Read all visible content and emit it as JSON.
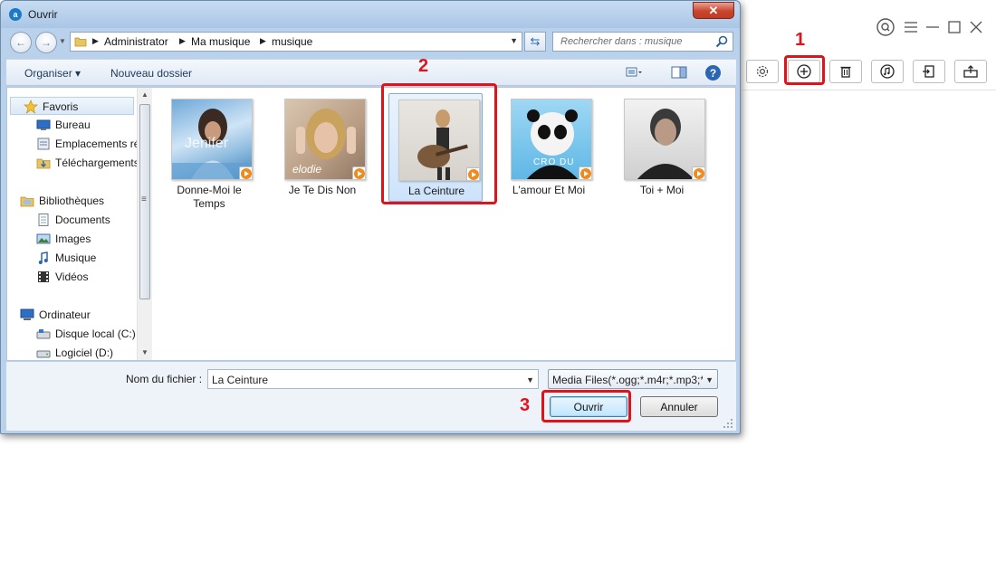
{
  "dialog": {
    "title": "Ouvrir",
    "close_symbol": "✕",
    "breadcrumb": [
      "Administrator",
      "Ma musique",
      "musique"
    ],
    "search_placeholder": "Rechercher dans : musique",
    "toolbar": {
      "organize": "Organiser ▾",
      "new_folder": "Nouveau dossier",
      "help": "?"
    },
    "nav": {
      "favorites": {
        "label": "Favoris",
        "items": [
          "Bureau",
          "Emplacements ré",
          "Téléchargements"
        ]
      },
      "libraries": {
        "label": "Bibliothèques",
        "items": [
          "Documents",
          "Images",
          "Musique",
          "Vidéos"
        ]
      },
      "computer": {
        "label": "Ordinateur",
        "items": [
          "Disque local (C:)",
          "Logiciel (D:)"
        ]
      }
    },
    "files": [
      {
        "name": "Donne-Moi le Temps",
        "cover_text": "Jenifer"
      },
      {
        "name": "Je Te Dis Non",
        "cover_text": "elodie"
      },
      {
        "name": "La Ceinture",
        "cover_text": ""
      },
      {
        "name": "L'amour Et Moi",
        "cover_text": "CRO DU"
      },
      {
        "name": "Toi + Moi",
        "cover_text": ""
      }
    ],
    "selected_file": "La Ceinture",
    "filename_label": "Nom du fichier :",
    "filename_value": "La Ceinture",
    "filter_value": "Media Files(*.ogg;*.m4r;*.mp3;*",
    "open_button": "Ouvrir",
    "cancel_button": "Annuler"
  },
  "callouts": {
    "one": "1",
    "two": "2",
    "three": "3"
  },
  "colors": {
    "highlight": "#e0131a",
    "selection": "#cde3fb",
    "accent": "#1b79c9"
  }
}
